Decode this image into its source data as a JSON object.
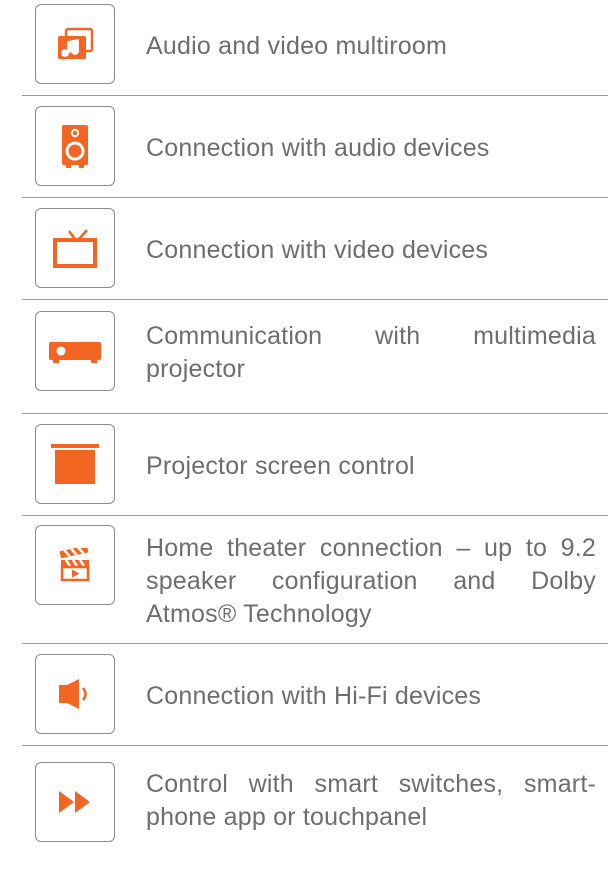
{
  "accent_color": "#f26522",
  "items": [
    {
      "icon": "music-files-icon",
      "label": "Audio and video multiroom"
    },
    {
      "icon": "speaker-icon",
      "label": "Connection with audio devices"
    },
    {
      "icon": "tv-icon",
      "label": "Connection with video devices"
    },
    {
      "icon": "projector-icon",
      "label": "Communication with multimedia projector"
    },
    {
      "icon": "projector-screen-icon",
      "label": "Projector screen control"
    },
    {
      "icon": "clapperboard-icon",
      "label": "Home theater connection – up to 9.2 speaker configuration and Dolby Atmos® Technology"
    },
    {
      "icon": "volume-icon",
      "label": "Connection with Hi-Fi devices"
    },
    {
      "icon": "fast-forward-icon",
      "label": "Control with smart switches, smart-phone app or touchpanel"
    }
  ]
}
